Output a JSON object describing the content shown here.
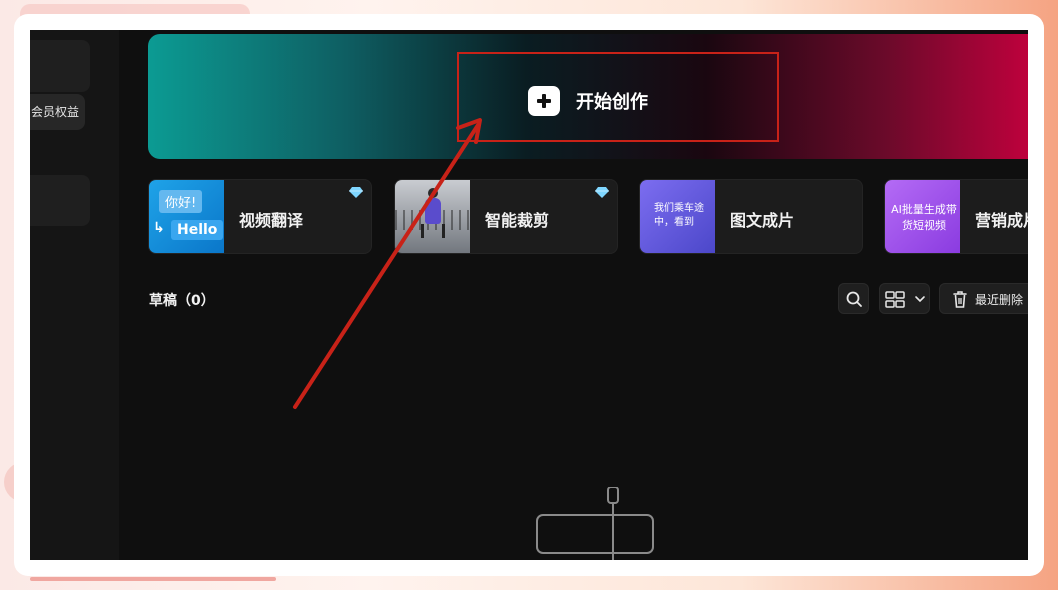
{
  "sidebar": {
    "benefits_label": "会员权益"
  },
  "banner": {
    "start_label": "开始创作"
  },
  "tools": [
    {
      "label": "视频翻译",
      "thumb_text_1": "你好!",
      "thumb_text_2": "Hello",
      "premium": true
    },
    {
      "label": "智能裁剪",
      "premium": true
    },
    {
      "label": "图文成片",
      "thumb_text": "我们乘车途中，看到"
    },
    {
      "label": "营销成片",
      "thumb_text": "AI批量生成带货短视频"
    }
  ],
  "drafts": {
    "title": "草稿（0）",
    "recent_delete_label": "最近删除"
  },
  "colors": {
    "accent_red": "#c82218",
    "background": "#0f0f0f",
    "gem": "#7fd6ff"
  },
  "icons": [
    "plus-icon",
    "diamond-icon",
    "search-icon",
    "grid-view-icon",
    "chevron-down-icon",
    "trash-icon"
  ]
}
